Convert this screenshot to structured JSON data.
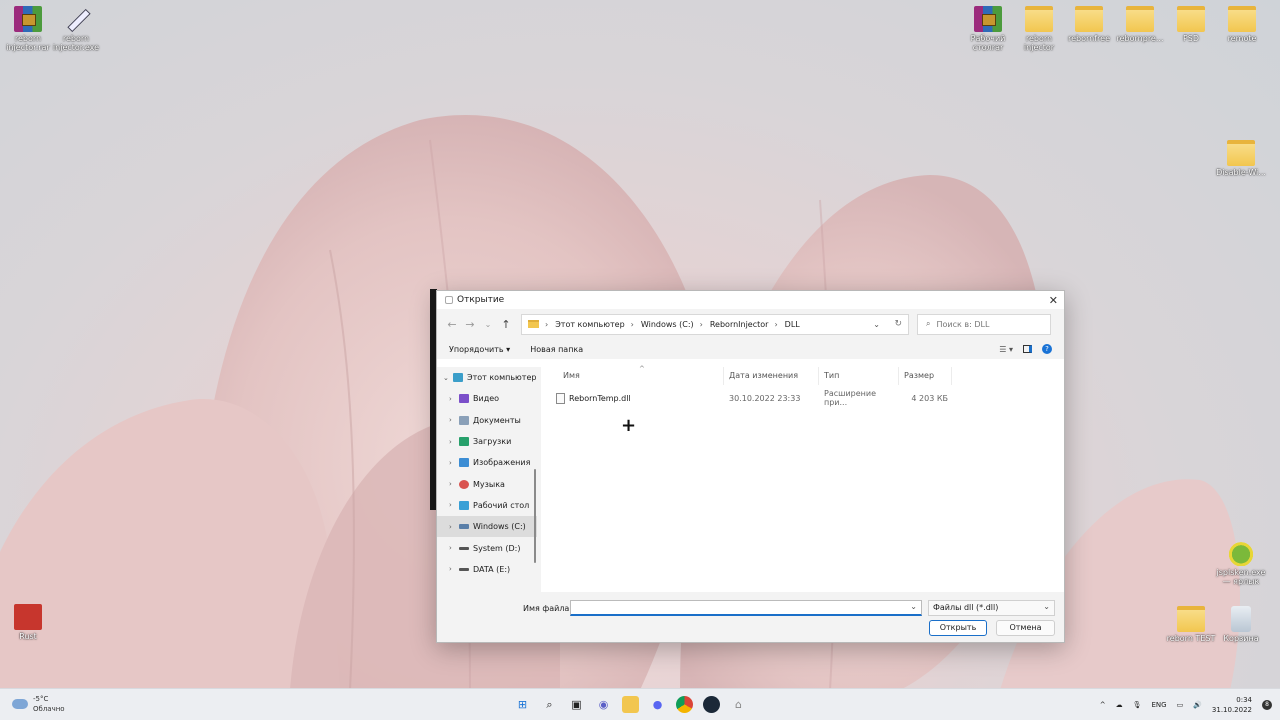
{
  "desktop": {
    "icons_left": [
      {
        "label": "reborn injector.rar",
        "icon": "winrar-archive-icon"
      },
      {
        "label": "reborn injector.exe",
        "icon": "syringe-icon"
      },
      {
        "label": "Rust",
        "icon": "rust-game-icon"
      }
    ],
    "icons_right": [
      {
        "label": "Рабочий столrar",
        "icon": "winrar-archive-icon"
      },
      {
        "label": "reborn injector",
        "icon": "folder-icon"
      },
      {
        "label": "rebornfree",
        "icon": "folder-icon"
      },
      {
        "label": "rebornpre...",
        "icon": "folder-icon"
      },
      {
        "label": "PSD",
        "icon": "folder-icon"
      },
      {
        "label": "remote",
        "icon": "folder-icon"
      },
      {
        "label": "Disable-Wi...",
        "icon": "folder-icon"
      },
      {
        "label": "jsplsken.exe — ярлык",
        "icon": "chameleon-icon"
      },
      {
        "label": "reborn TEST",
        "icon": "folder-icon"
      },
      {
        "label": "Корзина",
        "icon": "recycle-bin-icon"
      }
    ]
  },
  "dialog": {
    "title": "Открытие",
    "address": [
      "Этот компьютер",
      "Windows (C:)",
      "RebornInjector",
      "DLL"
    ],
    "search_placeholder": "Поиск в: DLL",
    "organize_label": "Упорядочить ▾",
    "new_folder_label": "Новая папка",
    "nav": [
      {
        "label": "Этот компьютер",
        "icon": "computer-icon",
        "color": "#3b9ec9"
      },
      {
        "label": "Видео",
        "icon": "video-icon",
        "color": "#7b4fc9"
      },
      {
        "label": "Документы",
        "icon": "documents-icon",
        "color": "#8aa0b8"
      },
      {
        "label": "Загрузки",
        "icon": "downloads-icon",
        "color": "#27a06b"
      },
      {
        "label": "Изображения",
        "icon": "pictures-icon",
        "color": "#3c8dd4"
      },
      {
        "label": "Музыка",
        "icon": "music-icon",
        "color": "#d9534f"
      },
      {
        "label": "Рабочий стол",
        "icon": "desktop-icon",
        "color": "#39a0d6"
      },
      {
        "label": "Windows (C:)",
        "icon": "drive-icon",
        "color": "#5a7fa8"
      },
      {
        "label": "System (D:)",
        "icon": "drive-icon",
        "color": "#555555"
      },
      {
        "label": "DATA (E:)",
        "icon": "drive-icon",
        "color": "#555555"
      }
    ],
    "columns": {
      "name": "Имя",
      "date": "Дата изменения",
      "type": "Тип",
      "size": "Размер"
    },
    "files": [
      {
        "name": "RebornTemp.dll",
        "date": "30.10.2022 23:33",
        "type": "Расширение при...",
        "size": "4 203 КБ"
      }
    ],
    "filename_label": "Имя файла:",
    "filename_value": "",
    "filetype": "Файлы dll (*.dll)",
    "open_label": "Открыть",
    "cancel_label": "Отмена"
  },
  "taskbar": {
    "temperature": "-5°C",
    "weather": "Облачно",
    "language": "ENG",
    "time": "0:34",
    "date": "31.10.2022",
    "notifications": "8"
  },
  "colors": {
    "accent": "#1a6fc9",
    "folder": "#f2c64f"
  }
}
